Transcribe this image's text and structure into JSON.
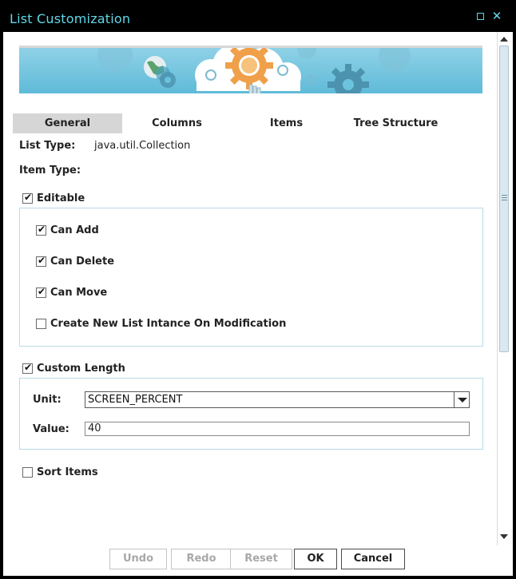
{
  "window": {
    "title": "List Customization"
  },
  "tabs": [
    "General",
    "Columns",
    "Items",
    "Tree Structure"
  ],
  "general": {
    "list_type_label": "List Type:",
    "list_type_value": "java.util.Collection",
    "item_type_label": "Item Type:",
    "item_type_value": ""
  },
  "editable": {
    "label": "Editable",
    "checked": true,
    "options": [
      {
        "label": "Can Add",
        "checked": true
      },
      {
        "label": "Can Delete",
        "checked": true
      },
      {
        "label": "Can Move",
        "checked": true
      },
      {
        "label": "Create New List Intance On Modification",
        "checked": false
      }
    ]
  },
  "custom_length": {
    "label": "Custom Length",
    "checked": true,
    "unit_label": "Unit:",
    "unit_value": "SCREEN_PERCENT",
    "value_label": "Value:",
    "value_value": "40"
  },
  "sort_items": {
    "label": "Sort Items",
    "checked": false
  },
  "buttons": {
    "undo": "Undo",
    "redo": "Redo",
    "reset": "Reset",
    "ok": "OK",
    "cancel": "Cancel"
  },
  "colors": {
    "title_text": "#5fd8e8",
    "banner_sky": "#6cc3dd",
    "group_border": "#b9dbe6"
  }
}
